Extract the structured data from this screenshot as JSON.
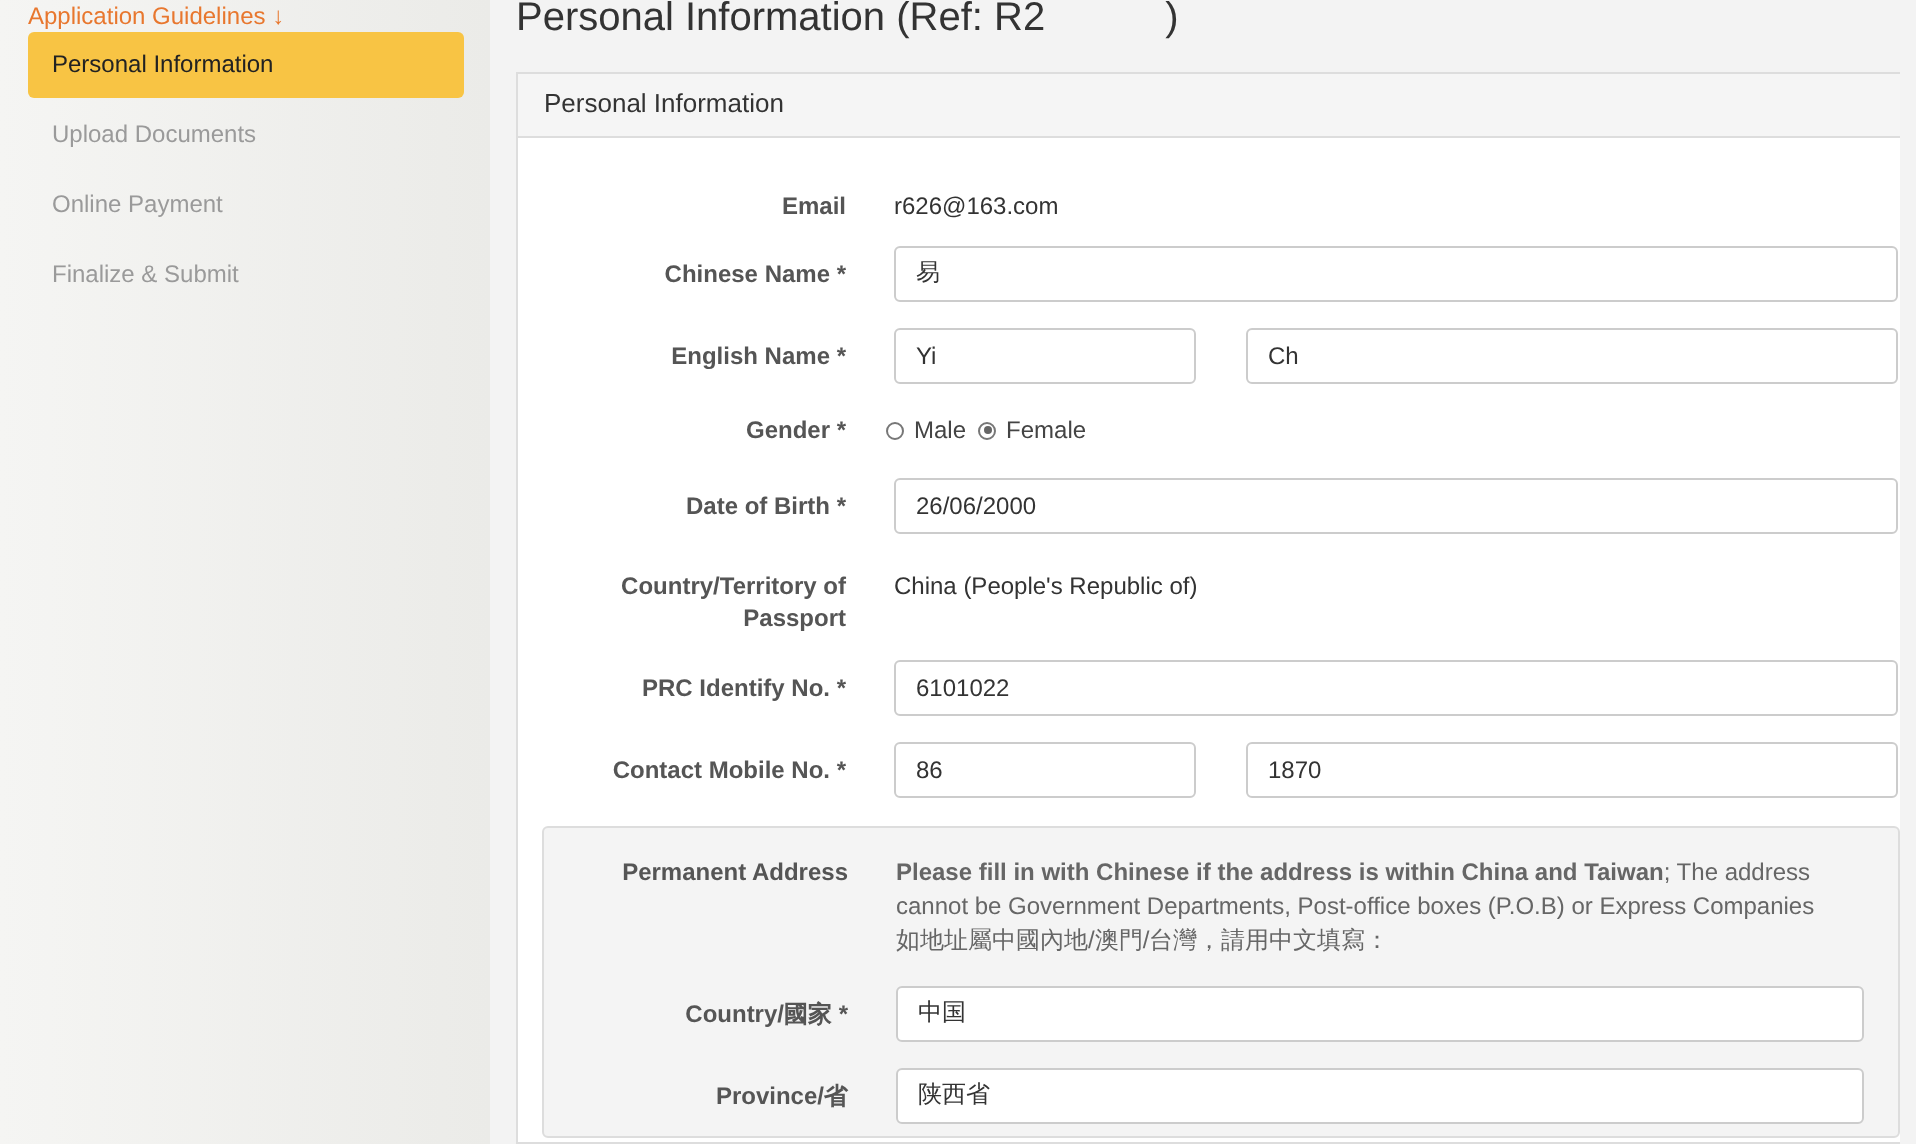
{
  "sidebar": {
    "guidelines_link": "Application Guidelines ↓",
    "items": [
      {
        "label": "Personal Information",
        "selected": true
      },
      {
        "label": "Upload Documents",
        "selected": false
      },
      {
        "label": "Online Payment",
        "selected": false
      },
      {
        "label": "Finalize & Submit",
        "selected": false
      }
    ]
  },
  "page_title": "Personal Information (Ref: R2",
  "closing_paren": ")",
  "panel": {
    "title": "Personal Information",
    "fields": [
      {
        "kind": "text",
        "label": "Email",
        "value": "r626@163.com"
      },
      {
        "kind": "input",
        "label": "Chinese Name *",
        "values": [
          "易"
        ]
      },
      {
        "kind": "input",
        "label": "English Name *",
        "values": [
          "Yi",
          "Ch"
        ]
      },
      {
        "kind": "radio",
        "label": "Gender *",
        "options": [
          {
            "label": "Male",
            "selected": false
          },
          {
            "label": "Female",
            "selected": true
          }
        ]
      },
      {
        "kind": "input",
        "label": "Date of Birth *",
        "values": [
          "26/06/2000"
        ]
      },
      {
        "kind": "text",
        "label": "Country/Territory of Passport",
        "value": "China (People's Republic of)"
      },
      {
        "kind": "input",
        "label": "PRC Identify No. *",
        "values": [
          "6101022"
        ]
      },
      {
        "kind": "input",
        "label": "Contact Mobile No. *",
        "values": [
          "86",
          "1870"
        ]
      }
    ],
    "address": {
      "label": "Permanent Address",
      "note": "**Please fill in with Chinese if the address is within China and Taiwan**; The address cannot be Government Departments, Post-office boxes (P.O.B) or Express Companies",
      "note_chinese": "如地址屬中國內地/澳門/台灣，請用中文填寫：",
      "fields": [
        {
          "label": "Country/國家 *",
          "value": "中国"
        },
        {
          "label": "Province/省",
          "value": "陕西省"
        }
      ]
    }
  }
}
